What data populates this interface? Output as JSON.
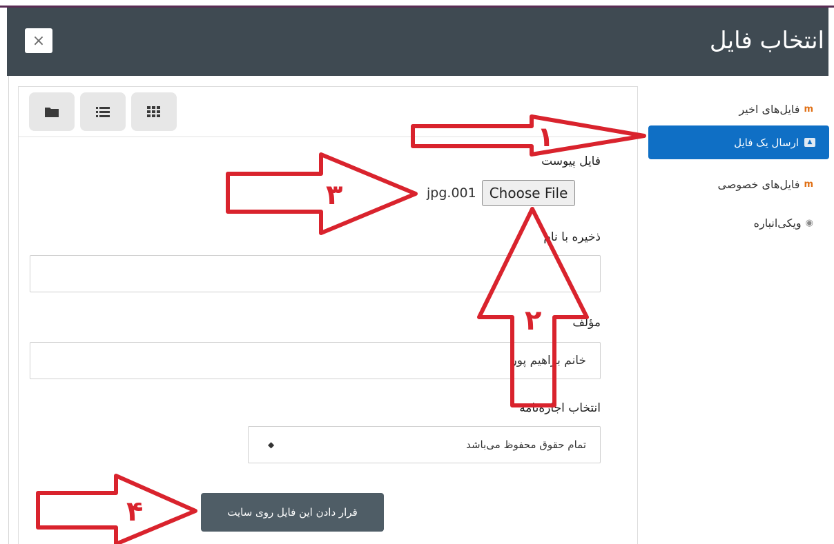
{
  "dialog": {
    "title": "انتخاب فایل",
    "close_icon": "close-icon",
    "close_glyph": "×"
  },
  "sidebar": {
    "items": [
      {
        "label": "فایل‌های اخیر",
        "icon": "moodle-icon",
        "icon_glyph": "m"
      },
      {
        "label": "ارسال یک فایل",
        "icon": "upload-icon",
        "active": true
      },
      {
        "label": "فایل‌های خصوصی",
        "icon": "moodle-icon",
        "icon_glyph": "m"
      },
      {
        "label": "ویکی‌انباره",
        "icon": "wikimedia-icon",
        "icon_glyph": "◉"
      }
    ],
    "active_color": "#0f6fc5"
  },
  "toolbar": {
    "views": [
      "folder-view",
      "list-view",
      "grid-view"
    ]
  },
  "form": {
    "attachment_label": "فایل پیوست",
    "choose_file_label": "Choose File",
    "selected_file": "jpg.001",
    "save_as_label": "ذخیره با نام",
    "save_as_value": "",
    "author_label": "مؤلف",
    "author_value": "خانم براهیم پور",
    "license_label": "انتخاب اجازه‌نامه",
    "license_value": "تمام حقوق محفوظ می‌باشد",
    "submit_label": "قرار دادن این فایل روی سایت"
  },
  "annotations": {
    "numbers": [
      "۱",
      "۲",
      "۳",
      "۴"
    ],
    "color": "#d9232d"
  }
}
